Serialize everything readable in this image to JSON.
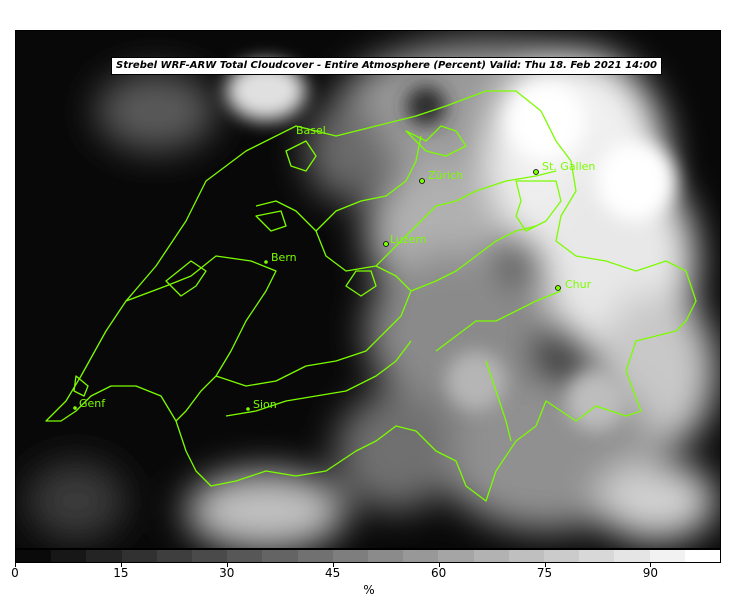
{
  "title": "Strebel WRF-ARW Total Cloudcover - Entire Atmosphere (Percent)   Valid: Thu 18. Feb 2021 14:00",
  "cities": [
    {
      "name": "Basel"
    },
    {
      "name": "Zürich"
    },
    {
      "name": "St. Gallen"
    },
    {
      "name": "Luzern"
    },
    {
      "name": "Bern"
    },
    {
      "name": "Chur"
    },
    {
      "name": "Genf"
    },
    {
      "name": "Sion"
    }
  ],
  "colorbar": {
    "ticks": [
      "0",
      "15",
      "30",
      "45",
      "60",
      "75",
      "90"
    ],
    "unit": "%",
    "levels": [
      0,
      5,
      10,
      15,
      20,
      25,
      30,
      35,
      40,
      45,
      50,
      55,
      60,
      65,
      70,
      75,
      80,
      85,
      90,
      95,
      100
    ]
  },
  "colors": {
    "border": "#7cfc00",
    "city_marker": "#7cfc00"
  }
}
